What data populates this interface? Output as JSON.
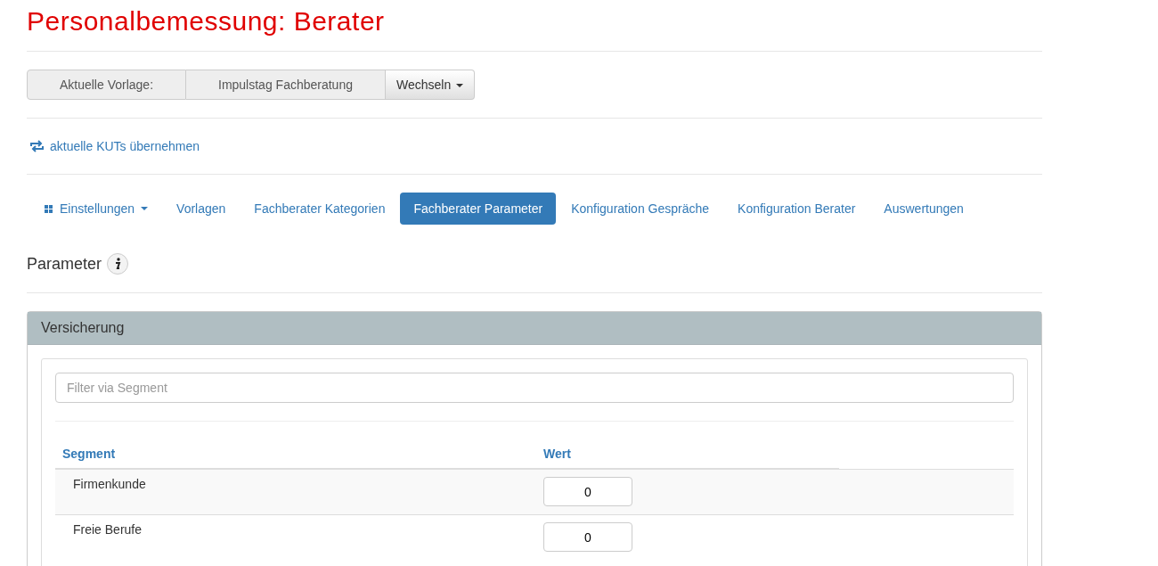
{
  "page": {
    "title": "Personalbemessung: Berater"
  },
  "template": {
    "label": "Aktuelle Vorlage:",
    "value": "Impulstag Fachberatung",
    "button": "Wechseln"
  },
  "action_link": "aktuelle KUTs übernehmen",
  "tabs": [
    {
      "label": "Einstellungen",
      "kind": "dropdown",
      "selected": false
    },
    {
      "label": "Vorlagen",
      "kind": "link",
      "selected": false
    },
    {
      "label": "Fachberater Kategorien",
      "kind": "link",
      "selected": false
    },
    {
      "label": "Fachberater Parameter",
      "kind": "link",
      "selected": true
    },
    {
      "label": "Konfiguration Gespräche",
      "kind": "link",
      "selected": false
    },
    {
      "label": "Konfiguration Berater",
      "kind": "link",
      "selected": false
    },
    {
      "label": "Auswertungen",
      "kind": "link",
      "selected": false
    }
  ],
  "section": {
    "title": "Parameter"
  },
  "panel": {
    "title": "Versicherung",
    "filter": {
      "placeholder": "Filter via Segment"
    },
    "table": {
      "columns": [
        "Segment",
        "Wert"
      ],
      "rows": [
        {
          "segment": "Firmenkunde",
          "value": "0"
        },
        {
          "segment": "Freie Berufe",
          "value": "0"
        }
      ]
    }
  }
}
